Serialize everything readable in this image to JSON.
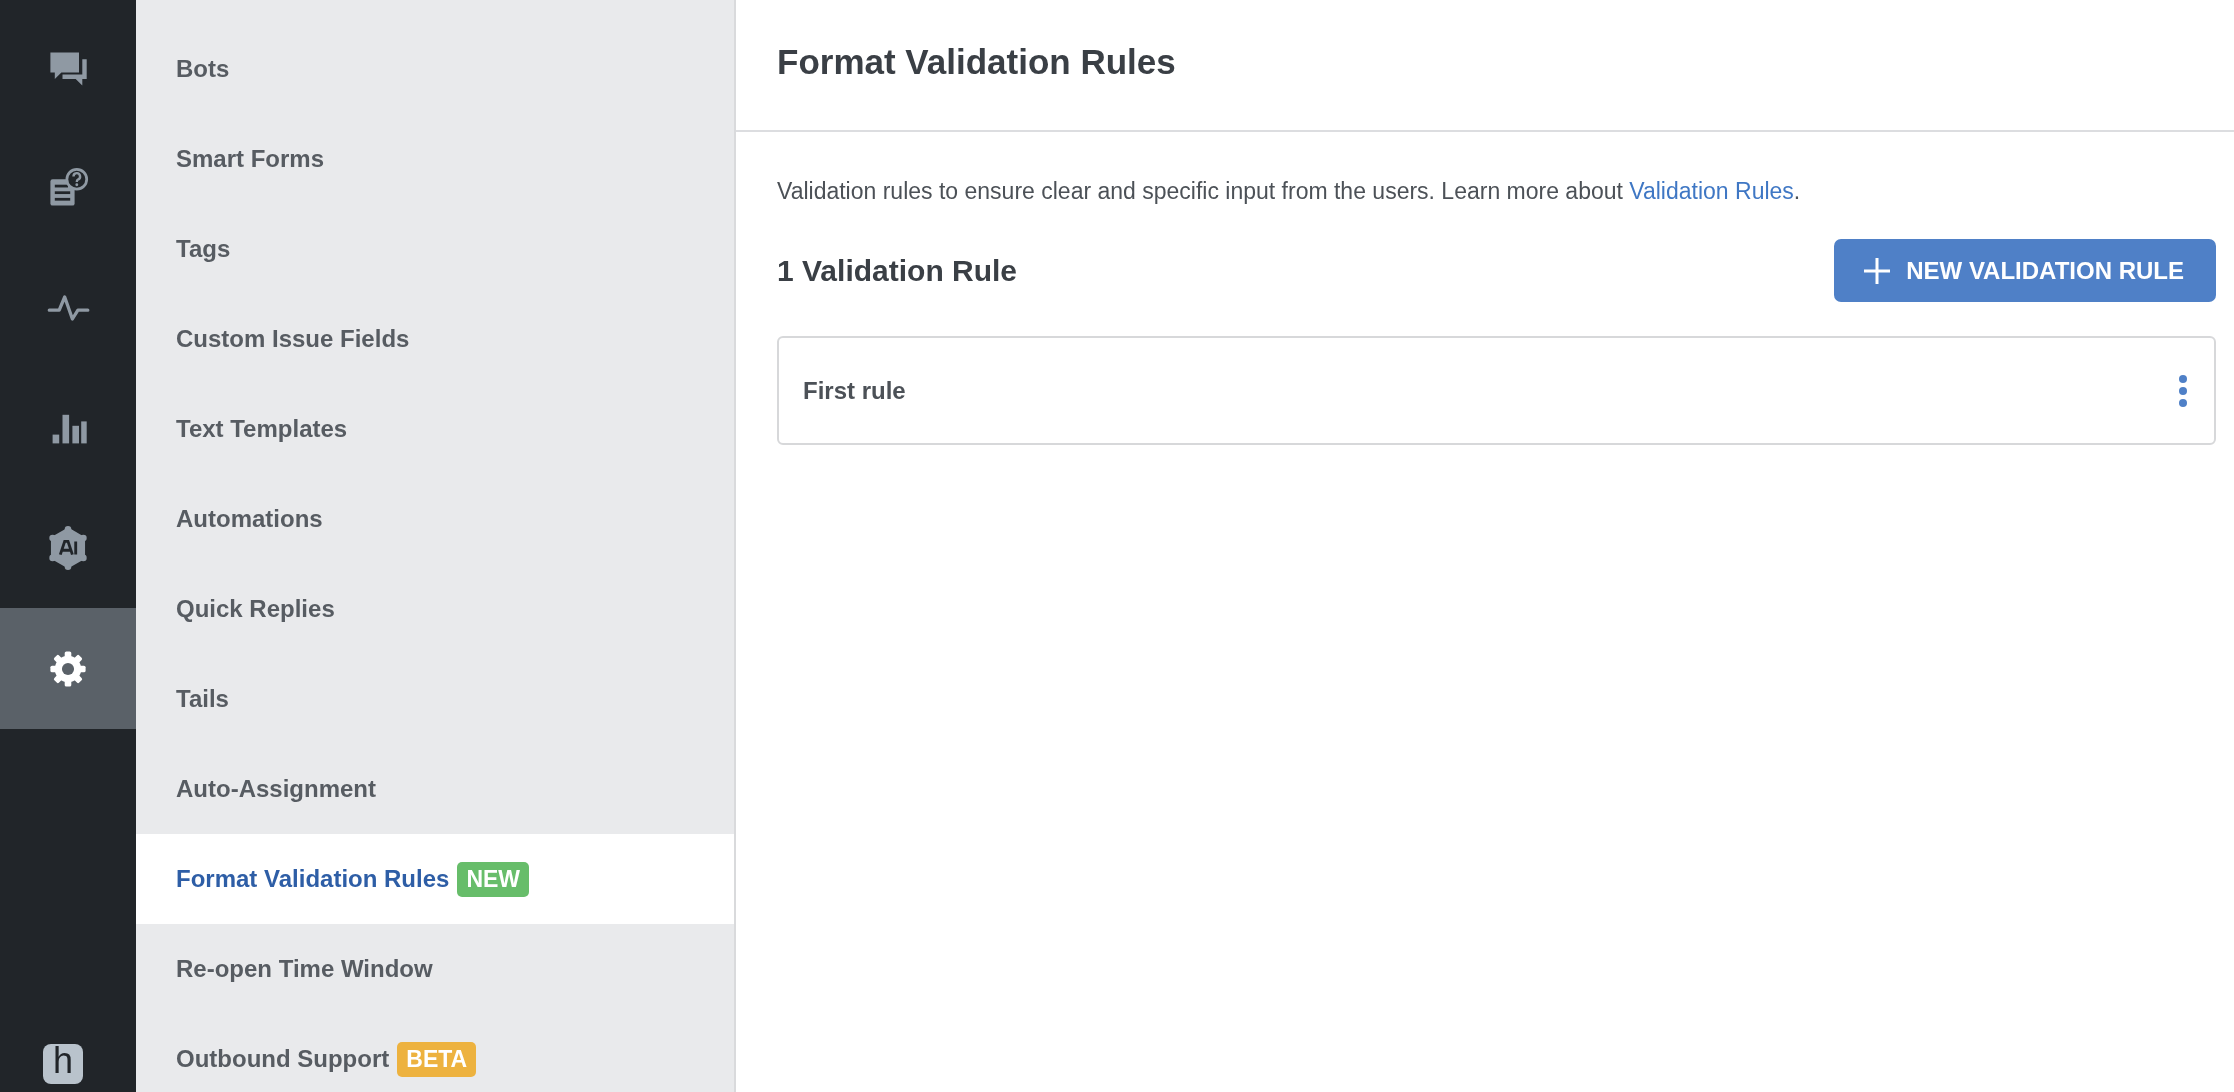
{
  "rail": {
    "items": [
      {
        "kind": "chat",
        "selected": false
      },
      {
        "kind": "help-doc",
        "selected": false
      },
      {
        "kind": "pulse",
        "selected": false
      },
      {
        "kind": "bars",
        "selected": false
      },
      {
        "kind": "ai",
        "selected": false
      },
      {
        "kind": "gear",
        "selected": true
      }
    ],
    "logo": "h"
  },
  "sidebar": {
    "items": [
      {
        "label": "Bots",
        "selected": false
      },
      {
        "label": "Smart Forms",
        "selected": false
      },
      {
        "label": "Tags",
        "selected": false
      },
      {
        "label": "Custom Issue Fields",
        "selected": false
      },
      {
        "label": "Text Templates",
        "selected": false
      },
      {
        "label": "Automations",
        "selected": false
      },
      {
        "label": "Quick Replies",
        "selected": false
      },
      {
        "label": "Tails",
        "selected": false
      },
      {
        "label": "Auto-Assignment",
        "selected": false
      },
      {
        "label": "Format Validation Rules",
        "selected": true,
        "badge": {
          "text": "NEW",
          "color": "#67bd6a"
        }
      },
      {
        "label": "Re-open Time Window",
        "selected": false
      },
      {
        "label": "Outbound Support",
        "selected": false,
        "badge": {
          "text": "BETA",
          "color": "#edb23f"
        }
      }
    ]
  },
  "main": {
    "title": "Format Validation Rules",
    "intro": {
      "text": "Validation rules to ensure clear and specific input from the users. Learn more about ",
      "link": "Validation Rules",
      "after": "."
    },
    "count": "1 Validation Rule",
    "new_button": "NEW VALIDATION RULE",
    "rules": [
      {
        "name": "First rule"
      }
    ]
  }
}
